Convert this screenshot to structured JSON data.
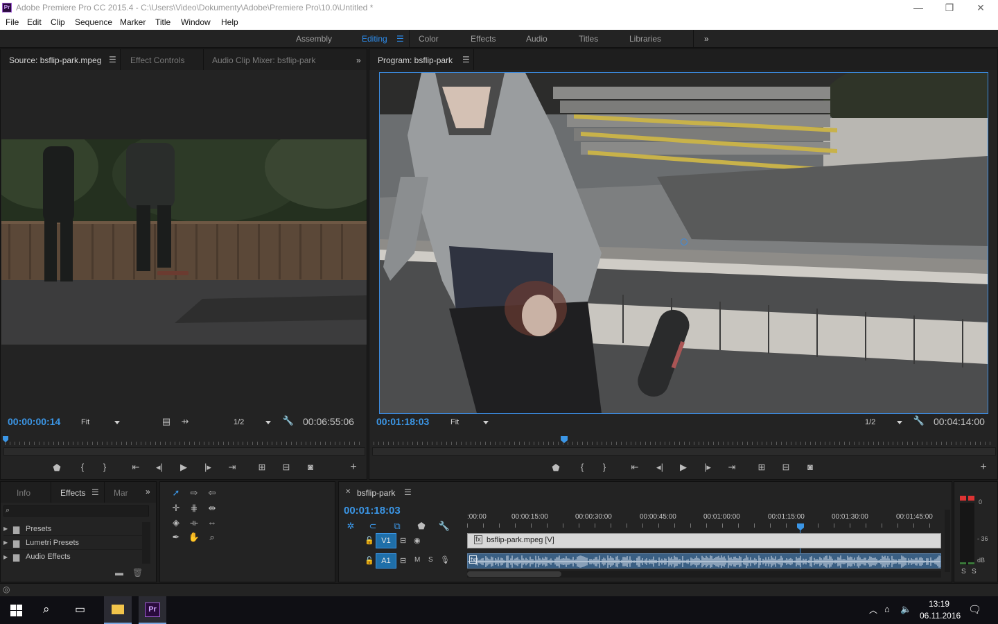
{
  "titlebar": {
    "logo": "Pr",
    "title": "Adobe Premiere Pro CC 2015.4 - C:\\Users\\Video\\Dokumenty\\Adobe\\Premiere Pro\\10.0\\Untitled *",
    "minimize": "—",
    "restore": "❐",
    "close": "✕"
  },
  "menu": [
    "File",
    "Edit",
    "Clip",
    "Sequence",
    "Marker",
    "Title",
    "Window",
    "Help"
  ],
  "workspaces": {
    "items": [
      "Assembly",
      "Editing",
      "Color",
      "Effects",
      "Audio",
      "Titles",
      "Libraries"
    ],
    "active": "Editing",
    "overflow": "»"
  },
  "source_panel": {
    "tabs": [
      "Source: bsflip-park.mpeg",
      "Effect Controls",
      "Audio Clip Mixer: bsflip-park"
    ],
    "overflow": "»",
    "timecode_current": "00:00:00:14",
    "fit": "Fit",
    "resolution": "1/2",
    "timecode_duration": "00:06:55:06",
    "playhead_fraction": 0.002
  },
  "program_panel": {
    "tab": "Program: bsflip-park",
    "timecode_current": "00:01:18:03",
    "fit": "Fit",
    "resolution": "1/2",
    "timecode_duration": "00:04:14:00",
    "playhead_fraction": 0.307
  },
  "effects_panel": {
    "tabs": [
      "Info",
      "Effects",
      "Mar"
    ],
    "overflow": "»",
    "items": [
      "Presets",
      "Lumetri Presets",
      "Audio Effects"
    ]
  },
  "timeline": {
    "tab": "bsflip-park",
    "timecode": "00:01:18:03",
    "ruler_labels": [
      ":00:00",
      "00:00:15:00",
      "00:00:30:00",
      "00:00:45:00",
      "00:01:00:00",
      "00:01:15:00",
      "00:01:30:00",
      "00:01:45:00"
    ],
    "tracks": [
      {
        "name": "V1",
        "clip": "bsflip-park.mpeg [V]"
      },
      {
        "name": "A1",
        "clip": ""
      }
    ],
    "a1_ms": [
      "M",
      "S"
    ]
  },
  "meters": {
    "labels": [
      "0",
      "- 36",
      "dB"
    ],
    "solo": [
      "S",
      "S"
    ]
  },
  "taskbar": {
    "time": "13:19",
    "date": "06.11.2016",
    "app_label": "Pr"
  },
  "colors": {
    "accent": "#2d8ceb",
    "timecode": "#3b96e6",
    "panel_bg": "#232323",
    "premiere_purple": "#9d5bd0"
  }
}
